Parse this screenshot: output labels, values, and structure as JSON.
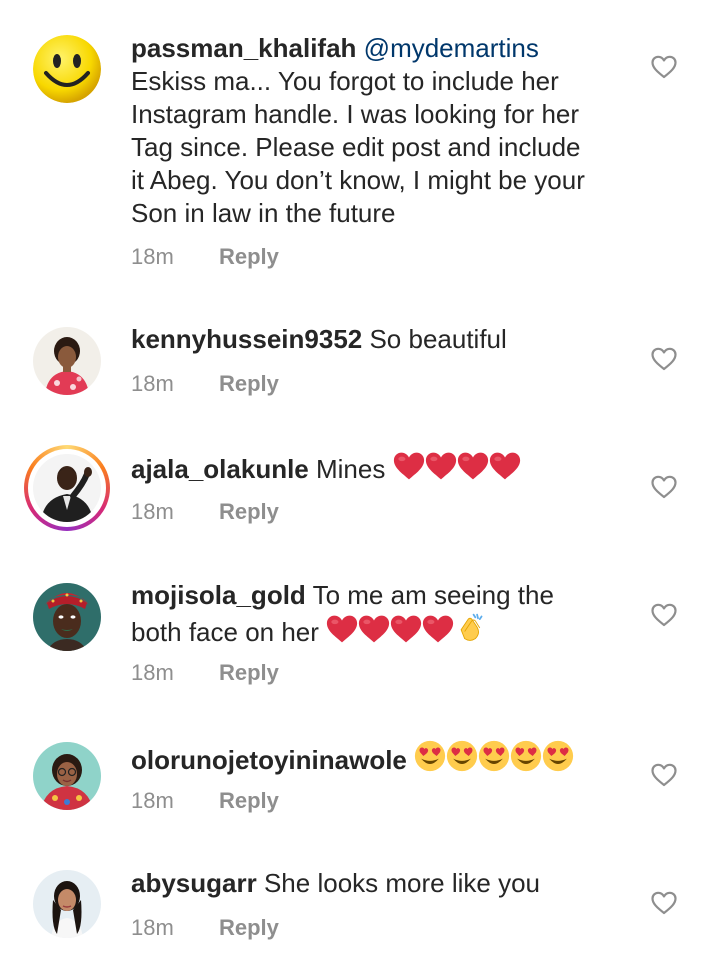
{
  "comments": [
    {
      "username": "passman_khalifah",
      "mention": "@mydemartins",
      "text_lines": [
        "Eskiss ma... You forgot to include her",
        "Instagram handle. I was looking for her",
        "Tag since. Please edit post and include",
        "it Abeg. You don’t know, I might be your",
        "Son in law in the future"
      ],
      "time": "18m",
      "reply_label": "Reply",
      "avatar_icon": "smiley-face-avatar"
    },
    {
      "username": "kennyhussein9352",
      "text": "So beautiful",
      "time": "18m",
      "reply_label": "Reply",
      "avatar_icon": "woman-photo-avatar"
    },
    {
      "username": "ajala_olakunle",
      "text": "Mines",
      "emojis": [
        "red-heart",
        "red-heart",
        "red-heart",
        "red-heart"
      ],
      "time": "18m",
      "reply_label": "Reply",
      "avatar_icon": "man-suit-avatar",
      "has_story_ring": true
    },
    {
      "username": "mojisola_gold",
      "text_line1": "To me am seeing the",
      "text_line2": "both face on her",
      "emojis": [
        "red-heart",
        "red-heart",
        "red-heart",
        "red-heart",
        "clapping-hands"
      ],
      "time": "18m",
      "reply_label": "Reply",
      "avatar_icon": "woman-headwrap-avatar"
    },
    {
      "username": "olorunojetoyininawole",
      "text": "",
      "emojis": [
        "heart-eyes",
        "heart-eyes",
        "heart-eyes",
        "heart-eyes",
        "heart-eyes"
      ],
      "time": "18m",
      "reply_label": "Reply",
      "avatar_icon": "woman-glasses-avatar"
    },
    {
      "username": "abysugarr",
      "text": "She looks more like you",
      "time": "18m",
      "reply_label": "Reply",
      "avatar_icon": "woman-portrait-avatar"
    }
  ],
  "colors": {
    "text": "#262626",
    "muted": "#8e8e8e",
    "mention": "#00376b",
    "heart_emoji": "#dd2e44"
  }
}
